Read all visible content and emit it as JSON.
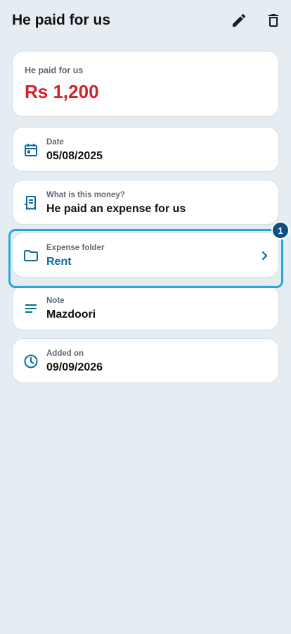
{
  "header": {
    "title": "He paid for us",
    "edit_icon": "pencil-icon",
    "delete_icon": "trash-icon"
  },
  "amount": {
    "label": "He paid for us",
    "value": "Rs 1,200",
    "color": "#d81f26"
  },
  "details": {
    "date": {
      "icon": "calendar-icon",
      "label": "Date",
      "value": "05/08/2025"
    },
    "type": {
      "icon": "receipt-icon",
      "label": "What is this money?",
      "value": "He paid an expense for us"
    },
    "folder": {
      "icon": "folder-icon",
      "label": "Expense folder",
      "value": "Rent",
      "chevron": "chevron-right-icon"
    },
    "note": {
      "icon": "notes-icon",
      "label": "Note",
      "value": "Mazdoori"
    },
    "added": {
      "icon": "clock-icon",
      "label": "Added on",
      "value": "09/09/2026"
    }
  },
  "annotation": {
    "badge": "1"
  },
  "colors": {
    "accent": "#0b6aa0",
    "background": "#e5edf3",
    "highlight": "#2aa6d8",
    "badge": "#0d4f86"
  }
}
